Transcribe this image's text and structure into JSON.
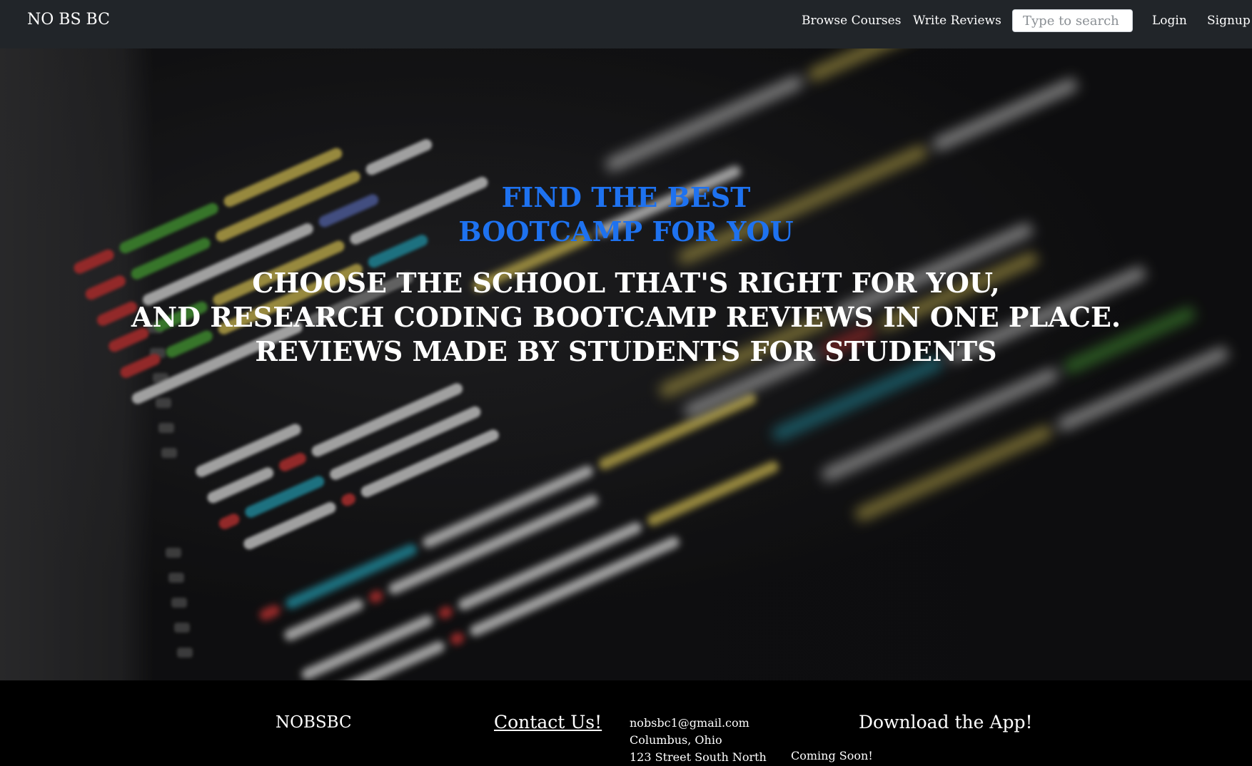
{
  "navbar": {
    "brand": "NO BS BC",
    "links": {
      "browse": "Browse Courses",
      "write": "Write Reviews",
      "login": "Login",
      "signup": "Signup"
    },
    "search": {
      "placeholder": "Type to search",
      "value": ""
    }
  },
  "hero": {
    "heading": [
      "FIND THE BEST",
      "BOOTCAMP FOR YOU"
    ],
    "subheading": [
      "CHOOSE THE SCHOOL THAT'S RIGHT FOR YOU,",
      "AND RESEARCH CODING BOOTCAMP REVIEWS IN ONE PLACE.",
      "REVIEWS MADE BY STUDENTS FOR STUDENTS"
    ],
    "background_image": "blurred code editor screenshot"
  },
  "footer": {
    "brand": "NOBSBC",
    "contact_link": "Contact Us!",
    "email": "nobsbc1@gmail.com",
    "city": "Columbus, Ohio",
    "street": "123 Street South North",
    "app_title": "Download the App!",
    "app_status": "Coming Soon!"
  },
  "colors": {
    "navbar_bg": "#212529",
    "heading_blue": "#1e72f0",
    "footer_bg": "#000000"
  }
}
